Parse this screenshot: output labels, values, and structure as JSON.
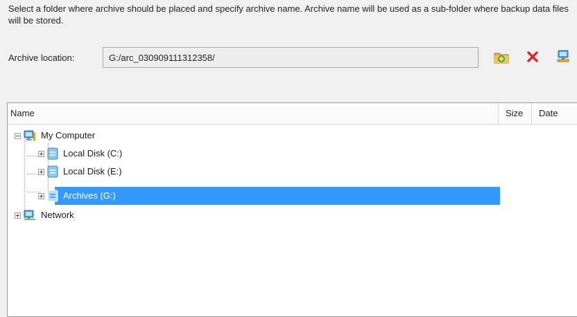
{
  "instructions": "Select a folder where archive should be placed and specify archive name. Archive name will be used as a sub-folder where backup data files will be stored.",
  "archive_location": {
    "label": "Archive location:",
    "value": "G:/arc_030909111312358/"
  },
  "toolbar": {
    "icons": [
      "new-folder-icon",
      "delete-icon",
      "network-icon"
    ]
  },
  "columns": {
    "name": "Name",
    "size": "Size",
    "date": "Date"
  },
  "tree": {
    "my_computer": "My Computer",
    "disk_c": "Local Disk (C:)",
    "disk_e": "Local Disk (E:)",
    "archives_g": "Archives (G:)",
    "network": "Network"
  },
  "colors": {
    "selection": "#3399ff",
    "delete_red": "#d9262a",
    "folder_green": "#7cc043"
  }
}
